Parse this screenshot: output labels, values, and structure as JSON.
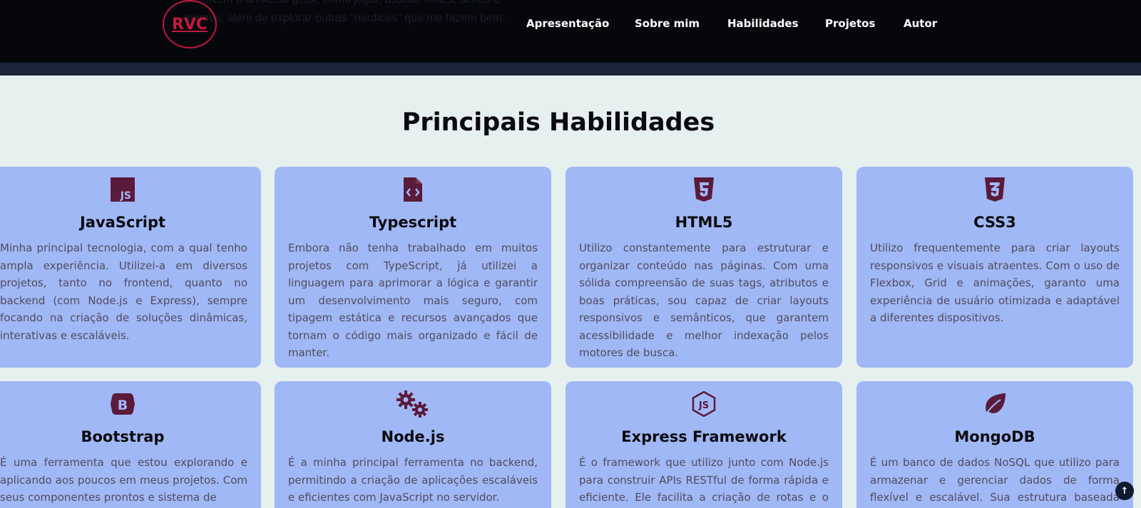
{
  "header": {
    "bleed_text_line1": "envolvem o universo geek, como jogar, assistir filmes, séries e",
    "bleed_text_line2": "animes, além de explorar outras \"nerdices\" que me fazem bem.",
    "logo": "RVC",
    "nav": [
      "Apresentação",
      "Sobre mim",
      "Habilidades",
      "Projetos",
      "Autor"
    ]
  },
  "section": {
    "title": "Principais Habilidades"
  },
  "cards": [
    {
      "icon": "javascript-icon",
      "title": "JavaScript",
      "text": "Minha principal tecnologia, com a qual tenho ampla experiência. Utilizei-a em diversos projetos, tanto no frontend, quanto no backend (com Node.js e Express), sempre focando na criação de soluções dinâmicas, interativas e escaláveis."
    },
    {
      "icon": "file-code-icon",
      "title": "Typescript",
      "text": "Embora não tenha trabalhado em muitos projetos com TypeScript, já utilizei a linguagem para aprimorar a lógica e garantir um desenvolvimento mais seguro, com tipagem estática e recursos avançados que tornam o código mais organizado e fácil de manter."
    },
    {
      "icon": "html5-icon",
      "title": "HTML5",
      "text": "Utilizo constantemente para estruturar e organizar conteúdo nas páginas. Com uma sólida compreensão de suas tags, atributos e boas práticas, sou capaz de criar layouts responsivos e semânticos, que garantem acessibilidade e melhor indexação pelos motores de busca."
    },
    {
      "icon": "css3-icon",
      "title": "CSS3",
      "text": "Utilizo frequentemente para criar layouts responsivos e visuais atraentes. Com o uso de Flexbox, Grid e animações, garanto uma experiência de usuário otimizada e adaptável a diferentes dispositivos."
    },
    {
      "icon": "bootstrap-icon",
      "title": "Bootstrap",
      "text": "É uma ferramenta que estou explorando e aplicando aos poucos em meus projetos. Com seus componentes prontos e sistema de"
    },
    {
      "icon": "gears-icon",
      "title": "Node.js",
      "text": "É a minha principal ferramenta no backend, permitindo a criação de aplicações escaláveis e eficientes com JavaScript no servidor."
    },
    {
      "icon": "nodejs-icon",
      "title": "Express Framework",
      "text": "É o framework que utilizo junto com Node.js para construir APIs RESTful de forma rápida e eficiente. Ele facilita a criação de rotas e o uso"
    },
    {
      "icon": "leaf-icon",
      "title": "MongoDB",
      "text": "É um banco de dados NoSQL que utilizo para armazenar e gerenciar dados de forma flexível e escalável. Sua estrutura baseada em"
    }
  ],
  "scroll_top": "↑",
  "colors": {
    "header_bg": "#06070d",
    "accent": "#c2183e",
    "card_bg": "#a1b8f6",
    "icon_color": "#5a1a3a",
    "page_bg": "#e6f0ef"
  }
}
